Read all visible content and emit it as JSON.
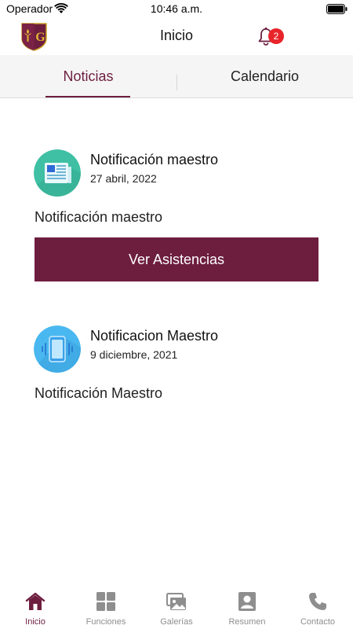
{
  "status": {
    "carrier": "Operador",
    "time": "10:46 a.m."
  },
  "header": {
    "title": "Inicio",
    "notification_count": "2"
  },
  "tabs": [
    {
      "label": "Noticias",
      "active": true
    },
    {
      "label": "Calendario",
      "active": false
    }
  ],
  "news": [
    {
      "icon": "newspaper-icon",
      "title": "Notificación maestro",
      "date": "27 abril, 2022",
      "body": "Notificación maestro",
      "button_label": "Ver Asistencias"
    },
    {
      "icon": "phone-vibrate-icon",
      "title": "Notificacion Maestro",
      "date": "9 diciembre, 2021",
      "body": "Notificación Maestro"
    }
  ],
  "bottom_nav": [
    {
      "label": "Inicio",
      "icon": "home-icon",
      "active": true
    },
    {
      "label": "Funciones",
      "icon": "grid-icon",
      "active": false
    },
    {
      "label": "Galerías",
      "icon": "gallery-icon",
      "active": false
    },
    {
      "label": "Resumen",
      "icon": "profile-icon",
      "active": false
    },
    {
      "label": "Contacto",
      "icon": "phone-icon",
      "active": false
    }
  ],
  "colors": {
    "accent": "#6d1e3f",
    "badge": "#e8242a",
    "inactive": "#8e8e8e"
  }
}
